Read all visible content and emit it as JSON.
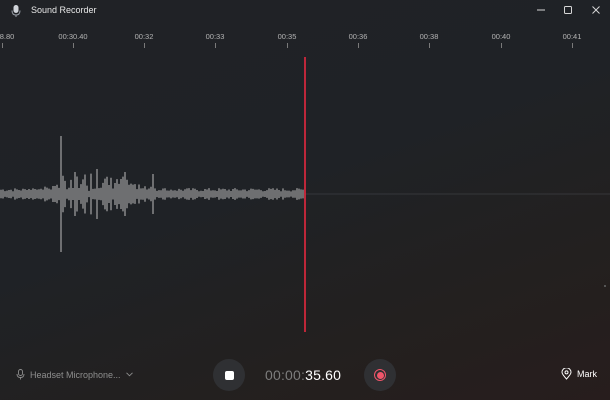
{
  "window": {
    "title": "Sound Recorder",
    "controls": [
      "minimize",
      "maximize",
      "close"
    ]
  },
  "timeline": {
    "ticks": [
      "8.80",
      "00:30.40",
      "00:32",
      "00:33",
      "00:35",
      "00:36",
      "00:38",
      "00:40",
      "00:41"
    ]
  },
  "waveform": {
    "playhead_color": "#e5293f",
    "wave_color": "#bcbcbc",
    "baseline_color": "#4a4d52"
  },
  "controls": {
    "microphone_label": "Headset Microphone...",
    "timer_prefix": "00:00:",
    "timer_value": "35.60",
    "mark_label": "Mark",
    "record_color": "#f0556a"
  }
}
